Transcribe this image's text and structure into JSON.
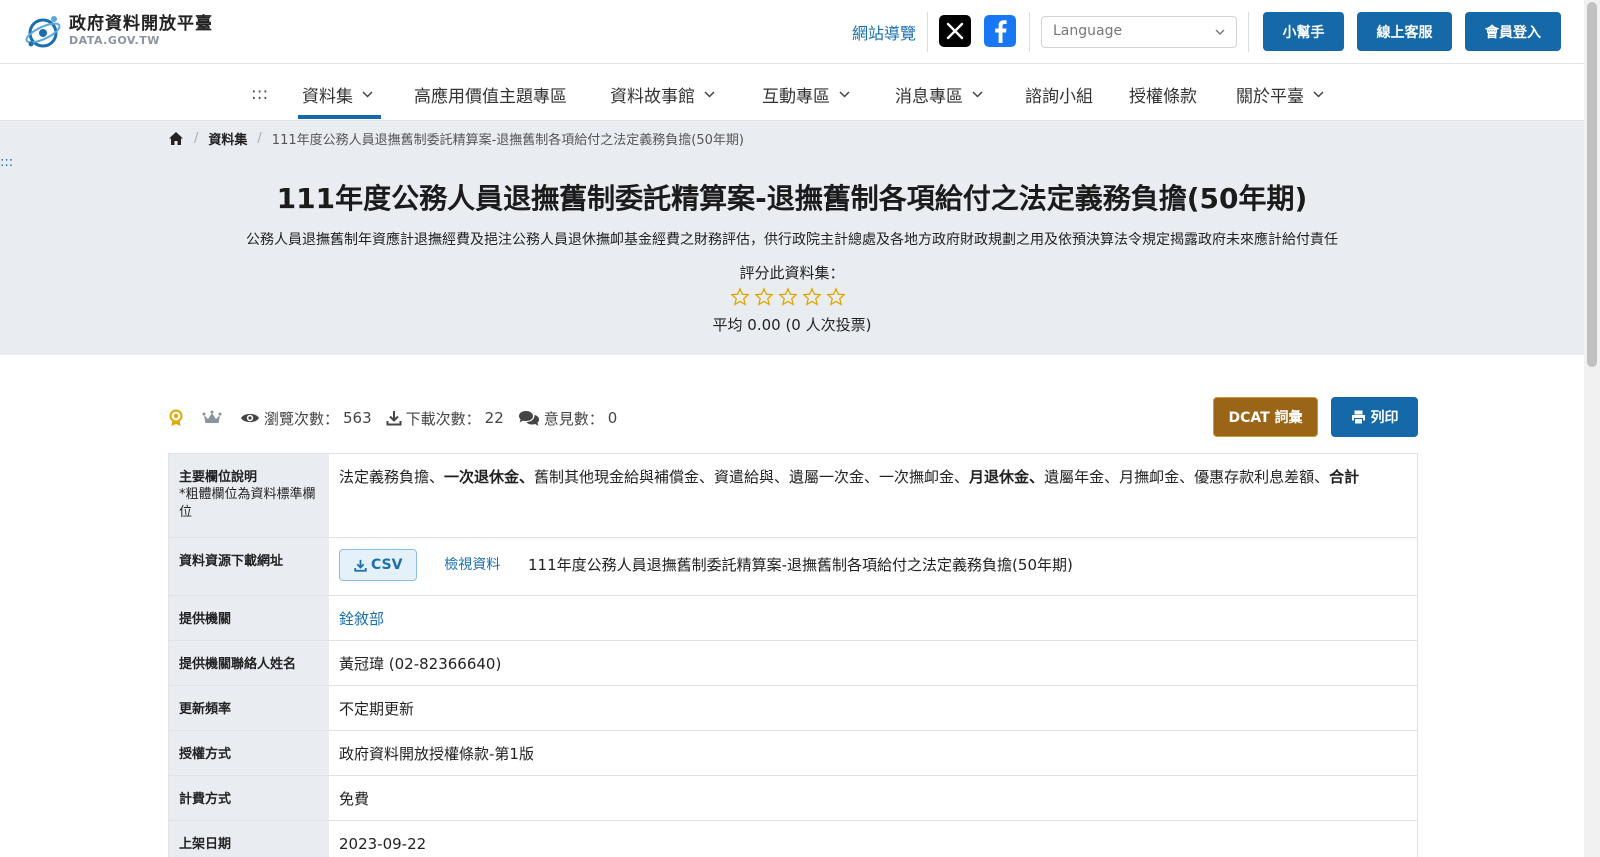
{
  "header": {
    "logo_cn": "政府資料開放平臺",
    "logo_en": "DATA.GOV.TW",
    "sitemap_label": "網站導覽",
    "language_placeholder": "Language",
    "helper_label": "小幫手",
    "support_label": "線上客服",
    "login_label": "會員登入"
  },
  "nav": {
    "accesskey": ":::",
    "items": [
      {
        "label": "資料集"
      },
      {
        "label": "高應用價值主題專區"
      },
      {
        "label": "資料故事館"
      },
      {
        "label": "互動專區"
      },
      {
        "label": "消息專區"
      },
      {
        "label": "諮詢小組"
      },
      {
        "label": "授權條款"
      },
      {
        "label": "關於平臺"
      }
    ]
  },
  "breadcrumb": {
    "dataset": "資料集",
    "current": "111年度公務人員退撫舊制委託精算案-退撫舊制各項給付之法定義務負擔(50年期)"
  },
  "hero": {
    "side_accesskey": ":::",
    "title": "111年度公務人員退撫舊制委託精算案-退撫舊制各項給付之法定義務負擔(50年期)",
    "description": "公務人員退撫舊制年資應計退撫經費及挹注公務人員退休撫卹基金經費之財務評估，供行政院主計總處及各地方政府財政規劃之用及依預決算法令規定揭露政府未來應計給付責任",
    "rate_label": "評分此資料集：",
    "rating_stars": 0,
    "average_text": "平均 0.00 (0 人次投票)"
  },
  "stats": {
    "views_label": "瀏覽次數：",
    "views": "563",
    "downloads_label": "下載次數：",
    "downloads": "22",
    "comments_label": "意見數：",
    "comments": "0"
  },
  "actions": {
    "dcat_label": "DCAT 詞彙",
    "print_label": "列印"
  },
  "table": {
    "fields_label": "主要欄位說明",
    "fields_note": "*粗體欄位為資料標準欄位",
    "fields": [
      {
        "text": "法定義務負擔、",
        "bold": false
      },
      {
        "text": "一次退休金、",
        "bold": true
      },
      {
        "text": "舊制其他現金給與補償金、資遣給與、遺屬一次金、一次撫卹金、",
        "bold": false
      },
      {
        "text": "月退休金、",
        "bold": true
      },
      {
        "text": "遺屬年金、月撫卹金、優惠存款利息差額、",
        "bold": false
      },
      {
        "text": "合計",
        "bold": true
      }
    ],
    "resource_label": "資料資源下載網址",
    "csv_label": "CSV",
    "view_label": "檢視資料",
    "resource_name": "111年度公務人員退撫舊制委託精算案-退撫舊制各項給付之法定義務負擔(50年期)",
    "provider_label": "提供機關",
    "provider": "銓敘部",
    "contact_label": "提供機關聯絡人姓名",
    "contact": "黃冠瑋 (02-82366640)",
    "frequency_label": "更新頻率",
    "frequency": "不定期更新",
    "license_label": "授權方式",
    "license": "政府資料開放授權條款-第1版",
    "fee_label": "計費方式",
    "fee": "免費",
    "publish_label": "上架日期",
    "publish_date": "2023-09-22"
  },
  "colors": {
    "primary": "#1669a8",
    "dcat": "#9a6516",
    "hero_bg": "#e9edf2",
    "star": "#e0a800"
  }
}
